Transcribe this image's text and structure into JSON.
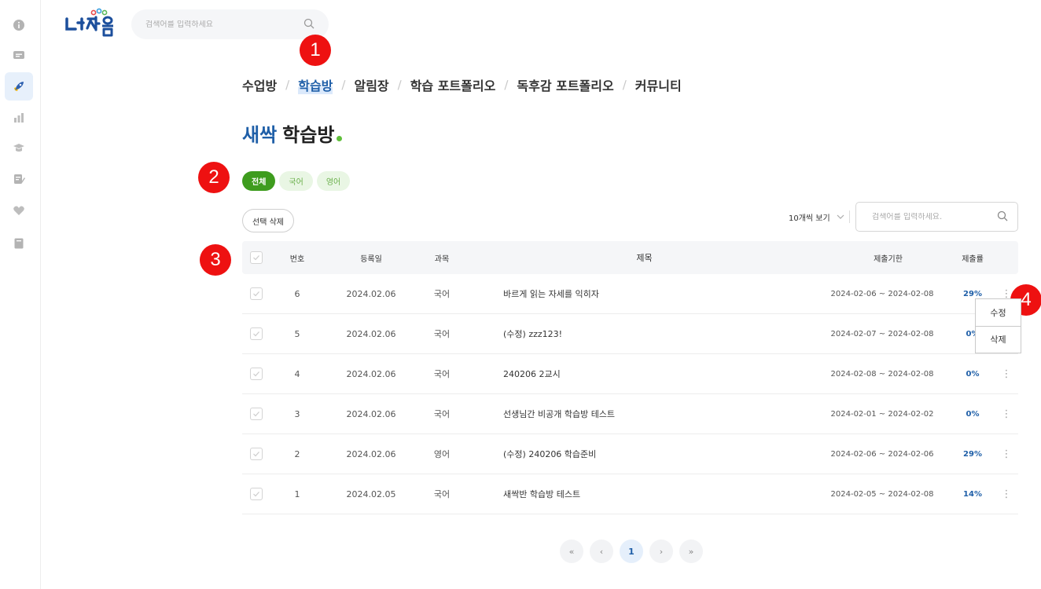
{
  "app": {
    "logo_text": "다채움"
  },
  "topbar": {
    "search_placeholder": "검색어를 입력하세요"
  },
  "markers": [
    "1",
    "2",
    "3",
    "4"
  ],
  "breadcrumb": [
    "수업방",
    "학습방",
    "알림장",
    "학습 포트폴리오",
    "독후감 포트폴리오",
    "커뮤니티"
  ],
  "title": {
    "accent": "새싹",
    "main": "학습방"
  },
  "chips": [
    "전체",
    "국어",
    "영어"
  ],
  "toolbar": {
    "delete_label": "선택 삭제",
    "per_page": "10개씩 보기",
    "search_placeholder": "검색어를 입력하세요."
  },
  "table": {
    "headers": {
      "no": "번호",
      "date": "등록일",
      "subject": "과목",
      "title": "제목",
      "due": "제출기한",
      "rate": "제출률"
    },
    "rows": [
      {
        "no": "6",
        "date": "2024.02.06",
        "subject": "국어",
        "title": "바르게 읽는 자세를 익히자",
        "due": "2024-02-06 ~ 2024-02-08",
        "rate": "29%"
      },
      {
        "no": "5",
        "date": "2024.02.06",
        "subject": "국어",
        "title": "(수정) zzz123!",
        "due": "2024-02-07 ~ 2024-02-08",
        "rate": "0%"
      },
      {
        "no": "4",
        "date": "2024.02.06",
        "subject": "국어",
        "title": "240206 2교시",
        "due": "2024-02-08 ~ 2024-02-08",
        "rate": "0%"
      },
      {
        "no": "3",
        "date": "2024.02.06",
        "subject": "국어",
        "title": "선생님간 비공개 학습방 테스트",
        "due": "2024-02-01 ~ 2024-02-02",
        "rate": "0%"
      },
      {
        "no": "2",
        "date": "2024.02.06",
        "subject": "영어",
        "title": "(수정) 240206 학습준비",
        "due": "2024-02-06 ~ 2024-02-06",
        "rate": "29%"
      },
      {
        "no": "1",
        "date": "2024.02.05",
        "subject": "국어",
        "title": "새싹반 학습방 테스트",
        "due": "2024-02-05 ~ 2024-02-08",
        "rate": "14%"
      }
    ]
  },
  "context_menu": [
    "수정",
    "삭제"
  ],
  "pagination": {
    "first": "«",
    "prev": "‹",
    "current": "1",
    "next": "›",
    "last": "»"
  },
  "colors": {
    "brand_blue": "#1f5fa8",
    "brand_green": "#3e9c1e",
    "marker_red": "#ee1111"
  },
  "rail_icons": [
    "info-icon",
    "card-icon",
    "rocket-icon",
    "bar-chart-icon",
    "graduation-cap-icon",
    "pencil-note-icon",
    "heart-icon",
    "book-icon"
  ]
}
